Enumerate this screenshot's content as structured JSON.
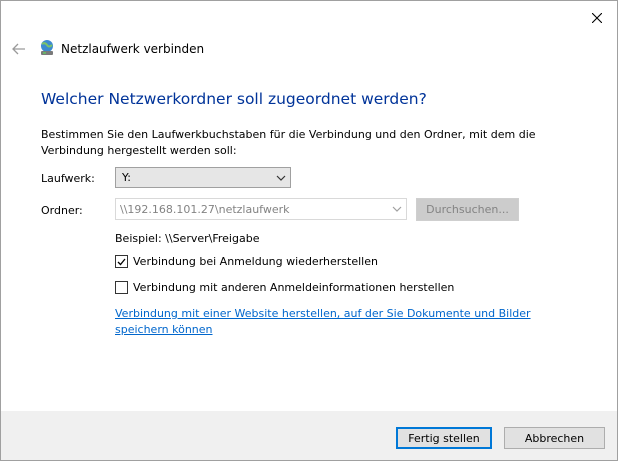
{
  "window": {
    "title": "Netzlaufwerk verbinden",
    "close_icon": "close-icon",
    "back_icon": "back-arrow-icon",
    "title_icon": "network-drive-icon"
  },
  "main": {
    "heading": "Welcher Netzwerkordner soll zugeordnet werden?",
    "description": "Bestimmen Sie den Laufwerkbuchstaben für die Verbindung und den Ordner, mit dem die Verbindung hergestellt werden soll:",
    "drive_label": "Laufwerk:",
    "drive_value": "Y:",
    "folder_label": "Ordner:",
    "folder_value": "\\\\192.168.101.27\\netzlaufwerk",
    "browse_label": "Durchsuchen...",
    "example": "Beispiel: \\\\Server\\Freigabe",
    "reconnect_label": "Verbindung bei Anmeldung wiederherstellen",
    "reconnect_checked": true,
    "credentials_label": "Verbindung mit anderen Anmeldeinformationen herstellen",
    "credentials_checked": false,
    "website_link": "Verbindung mit einer Website herstellen, auf der Sie Dokumente und Bilder speichern können"
  },
  "footer": {
    "finish_label": "Fertig stellen",
    "cancel_label": "Abbrechen"
  },
  "colors": {
    "heading": "#003399",
    "link": "#0066cc",
    "accent": "#0078d7"
  }
}
